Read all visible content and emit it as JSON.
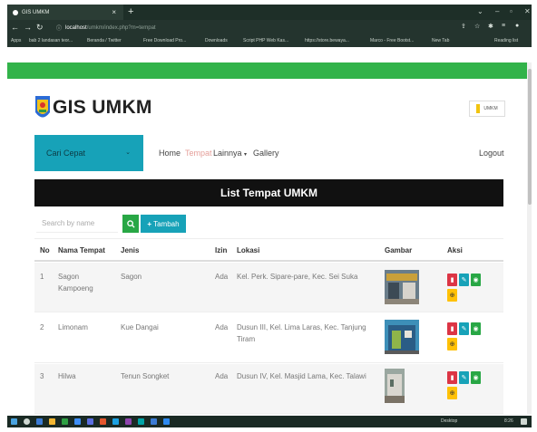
{
  "browser": {
    "tab_title": "GIS UMKM",
    "tab_close": "×",
    "new_tab": "+",
    "url_host": "localhost",
    "url_path": "/umkm/index.php?m=tempat",
    "bookmarks": [
      "Apps",
      "bab 2 landasan teor...",
      "Beranda / Twitter",
      "Free Download Pro...",
      "Downloads",
      "Script PHP Web Kas...",
      "https://store.bewaya...",
      "Marco - Free Bootst...",
      "New Tab"
    ],
    "reading_list": "Reading list"
  },
  "header": {
    "brand": "GIS UMKM",
    "umkm_button": "UMKM"
  },
  "nav": {
    "cari_cepat": "Cari Cepat",
    "home": "Home",
    "tempat": "Tempat",
    "lainnya": "Lainnya",
    "gallery": "Gallery",
    "logout": "Logout"
  },
  "page": {
    "title": "List Tempat UMKM",
    "search_placeholder": "Search by name",
    "add_label": "Tambah"
  },
  "table": {
    "headers": [
      "No",
      "Nama Tempat",
      "Jenis",
      "Izin",
      "Lokasi",
      "Gambar",
      "Aksi"
    ],
    "rows": [
      {
        "no": "1",
        "nama": "Sagon Kampoeng",
        "jenis": "Sagon",
        "izin": "Ada",
        "lokasi": "Kel. Perk. Sipare-pare, Kec. Sei Suka"
      },
      {
        "no": "2",
        "nama": "Limonam",
        "jenis": "Kue Dangai",
        "izin": "Ada",
        "lokasi": "Dusun III, Kel. Lima Laras, Kec. Tanjung Tiram"
      },
      {
        "no": "3",
        "nama": "Hilwa",
        "jenis": "Tenun Songket",
        "izin": "Ada",
        "lokasi": "Dusun IV, Kel. Masjid Lama, Kec. Talawi"
      }
    ]
  },
  "taskbar": {
    "tray_label": "Desktop",
    "time": "8:26"
  },
  "colors": {
    "green_bar": "#32b34a",
    "teal": "#17a2b8",
    "success": "#28a745",
    "danger": "#dc3545",
    "warning": "#ffc107"
  }
}
